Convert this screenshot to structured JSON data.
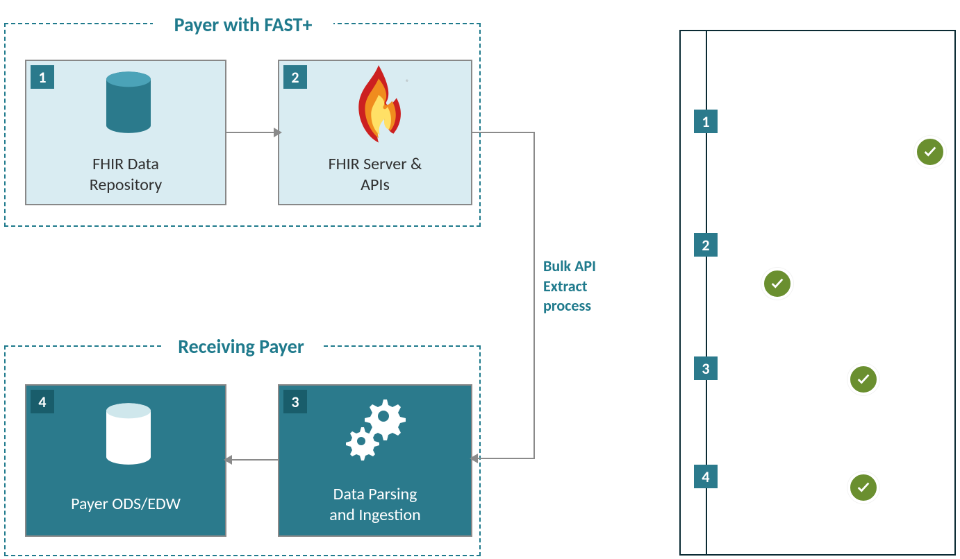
{
  "groups": {
    "payer_fast": {
      "title": "Payer with FAST+"
    },
    "receiving": {
      "title": "Receiving Payer"
    }
  },
  "nodes": {
    "n1": {
      "num": "1",
      "label_l1": "FHIR Data",
      "label_l2": "Repository"
    },
    "n2": {
      "num": "2",
      "label_l1": "FHIR Server &",
      "label_l2": "APIs"
    },
    "n3": {
      "num": "3",
      "label_l1": "Data Parsing",
      "label_l2": "and Ingestion"
    },
    "n4": {
      "num": "4",
      "label_l1": "Payer ODS/EDW",
      "label_l2": ""
    }
  },
  "api_label": {
    "l1": "Bulk API",
    "l2": "Extract",
    "l3": "process"
  },
  "side": {
    "s1": "1",
    "s2": "2",
    "s3": "3",
    "s4": "4"
  }
}
